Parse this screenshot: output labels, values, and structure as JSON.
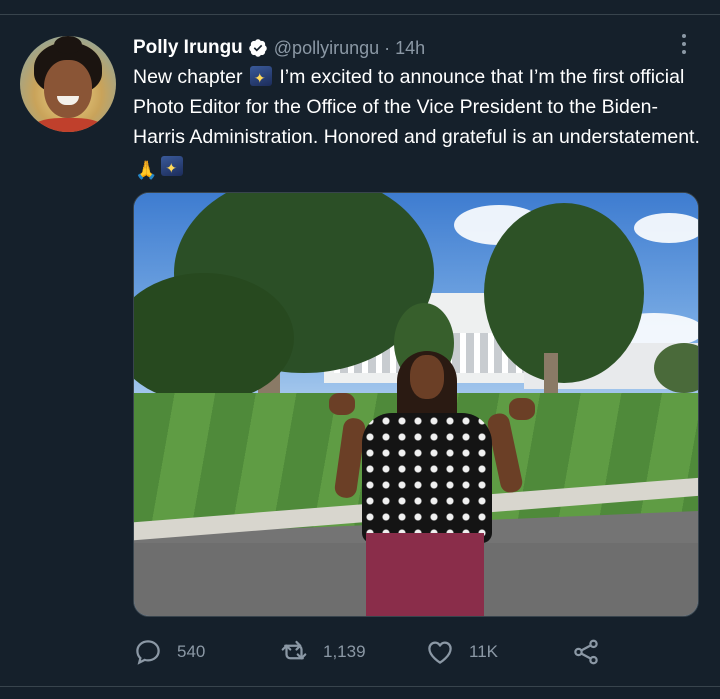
{
  "tweet": {
    "author": {
      "name": "Polly Irungu",
      "handle": "@pollyirungu",
      "verified": true
    },
    "time_separator": "·",
    "time": "14h",
    "text_parts": [
      "New chapter",
      "I’m excited to announce that I’m the first official Photo Editor for the Office of the Vice President to the Biden-Harris Administration. Honored and grateful is an understatement."
    ],
    "emojis": [
      "sparkler-emoji",
      "folded-hands-emoji",
      "sparkler-emoji"
    ],
    "actions": {
      "reply": {
        "icon": "reply-icon",
        "count": "540"
      },
      "retweet": {
        "icon": "retweet-icon",
        "count": "1,139"
      },
      "like": {
        "icon": "heart-icon",
        "count": "11K"
      },
      "share": {
        "icon": "share-icon"
      }
    }
  },
  "colors": {
    "background": "#15202b",
    "text_primary": "#ffffff",
    "text_secondary": "#8b98a5",
    "divider": "#38444d",
    "verified_badge": "#ffffff"
  }
}
